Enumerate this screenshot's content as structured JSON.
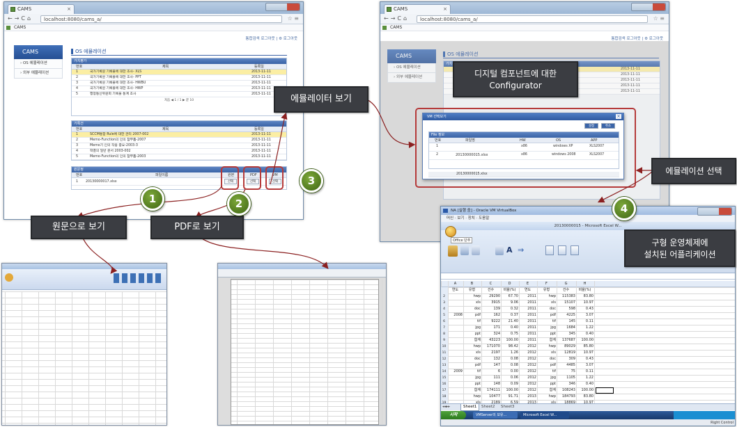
{
  "browser": {
    "tab_title": "CAMS",
    "url": "localhost:8080/cams_a/",
    "bookmark": "CAMS",
    "topright_links": "통합검색 로그아웃 | ⚙ 로그아웃"
  },
  "cams": {
    "app_title": "CAMS",
    "sidebar_items": [
      "› OS 에뮬레이션",
      "› 외부 에뮬레이션"
    ],
    "page_title": "OS 에뮬레이션",
    "section1": {
      "header": "가치평가",
      "columns": [
        "번호",
        "제목",
        "등록일"
      ],
      "rows": [
        {
          "no": "1",
          "title": "국가기록원 기록물에 대한 조사- XLS",
          "date": "2013-11-11",
          "highlight": true
        },
        {
          "no": "2",
          "title": "국가기록원 기록물에 대한 조사- PPT",
          "date": "2013-11-11",
          "highlight": false
        },
        {
          "no": "3",
          "title": "국가기록원 기록물에 대한 조사- HWBU",
          "date": "2013-11-11",
          "highlight": false
        },
        {
          "no": "4",
          "title": "국가기록원 기록물에 대한 조사- HWP",
          "date": "2013-11-11",
          "highlight": false
        },
        {
          "no": "5",
          "title": "행정통신위원회 기록물 통계 조사",
          "date": "2013-11-11",
          "highlight": false
        }
      ],
      "pager": "처음 ◀ 1 / 1 ▶ 끝 10"
    },
    "section2": {
      "header": "기록건",
      "columns": [
        "번호",
        "제목",
        "등록일"
      ],
      "rows": [
        {
          "no": "1",
          "title": "SCCM통합 Rule에 대한 관리 2007-002",
          "date": "2013-11-11",
          "highlight": true
        },
        {
          "no": "2",
          "title": "Memo-Function의 인의 참부품-2007",
          "date": "2013-11-11",
          "highlight": false
        },
        {
          "no": "3",
          "title": "Memo기 인의 작용 중요-2003-3",
          "date": "2013-11-11",
          "highlight": false
        },
        {
          "no": "4",
          "title": "학결의 일반 문서 2003-002",
          "date": "2013-11-11",
          "highlight": false
        },
        {
          "no": "5",
          "title": "Memo-Function의 인의 참부품-2003",
          "date": "2013-11-11",
          "highlight": false
        }
      ]
    },
    "section3": {
      "header": "원문정",
      "columns": [
        "번호",
        "파일이름",
        "원본",
        "PDF",
        "VM"
      ],
      "rows": [
        {
          "no": "1",
          "file": "20130000017.xlsx",
          "original": "선택",
          "pdf": "선택",
          "vm": "선택"
        }
      ]
    }
  },
  "callouts": {
    "original_view": "원문으로 보기",
    "pdf_view": "PDF로 보기",
    "emulator_view": "에뮬레이터 보기",
    "configurator_line1": "디지털 컴포넌트에 대한",
    "configurator_line2": "Configurator",
    "emulation_select": "에뮬레이션 선택",
    "app_line1": "구형 운영체제에",
    "app_line2": "설치된 어플리케이션"
  },
  "badges": [
    "1",
    "2",
    "3",
    "4"
  ],
  "vm_dialog": {
    "title": "VM 선택보기",
    "buttons": [
      "설정",
      "취소"
    ],
    "section": "File 정보",
    "columns": [
      "번호",
      "파일명",
      "HW",
      "OS",
      "APP"
    ],
    "rows": [
      {
        "no": "1",
        "hw": "x86",
        "os": "windows XP",
        "app": "XLS2007"
      },
      {
        "no": "2",
        "hw": "x86",
        "os": "windows 2008",
        "app": "XLS2007"
      }
    ],
    "file": "20130000015.xlsx"
  },
  "vm_window": {
    "title": "NA [실행 중] - Oracle VM VirtualBox",
    "menu": "머신 · 보기 · 장치 · 도움말",
    "excel_title": "20130000015 - Microsoft Excel W...",
    "office_button": "Office 단추",
    "sheet_tabs": [
      "Sheet1",
      "Sheet2",
      "Sheet3"
    ],
    "taskbar_start": "시작",
    "taskbar_items": [
      "VMServer의 보유...",
      "Microsoft Excel W..."
    ],
    "tray": "Right Control",
    "col_headers": [
      "A",
      "B",
      "C",
      "D",
      "E",
      "F",
      "G",
      "H"
    ],
    "header_row": [
      "연도",
      "유형",
      "건수",
      "비율(%)",
      "연도",
      "유형",
      "건수",
      "비율(%)"
    ],
    "rows": [
      [
        "",
        "hwp",
        "29290",
        "67.70",
        "2011",
        "hwp",
        "115383",
        "83.80"
      ],
      [
        "",
        "xls",
        "3915",
        "9.06",
        "2011",
        "xls",
        "15107",
        "10.97"
      ],
      [
        "",
        "doc",
        "139",
        "0.32",
        "2011",
        "doc",
        "598",
        "0.43"
      ],
      [
        "2008",
        "pdf",
        "162",
        "0.37",
        "2011",
        "pdf",
        "4225",
        "3.07"
      ],
      [
        "",
        "tif",
        "9222",
        "21.40",
        "2011",
        "tif",
        "145",
        "0.11"
      ],
      [
        "",
        "jpg",
        "171",
        "0.40",
        "2011",
        "jpg",
        "1684",
        "1.22"
      ],
      [
        "",
        "ppt",
        "324",
        "0.75",
        "2011",
        "ppt",
        "345",
        "0.40"
      ],
      [
        "",
        "합계",
        "43223",
        "100.00",
        "2011",
        "합계",
        "137687",
        "100.00"
      ],
      [
        "",
        "hwp",
        "171070",
        "98.42",
        "2012",
        "hwp",
        "89029",
        "85.80"
      ],
      [
        "",
        "xls",
        "2197",
        "1.26",
        "2012",
        "xls",
        "12819",
        "10.97"
      ],
      [
        "",
        "doc",
        "132",
        "0.08",
        "2012",
        "doc",
        "309",
        "0.43"
      ],
      [
        "",
        "pdf",
        "147",
        "0.08",
        "2012",
        "pdf",
        "4485",
        "3.07"
      ],
      [
        "2009",
        "tif",
        "6",
        "0.00",
        "2012",
        "tif",
        "75",
        "0.11"
      ],
      [
        "",
        "jpg",
        "111",
        "0.06",
        "2012",
        "jpg",
        "1105",
        "1.22"
      ],
      [
        "",
        "ppt",
        "148",
        "0.09",
        "2012",
        "ppt",
        "346",
        "0.40"
      ],
      [
        "",
        "합계",
        "174111",
        "100.00",
        "2012",
        "합계",
        "108243",
        "100.00"
      ],
      [
        "",
        "hwp",
        "10477",
        "91.71",
        "2013",
        "hwp",
        "184793",
        "83.80"
      ],
      [
        "",
        "xls",
        "2189",
        "6.59",
        "2013",
        "xls",
        "18869",
        "10.97"
      ],
      [
        "",
        "doc",
        "26",
        "0.08",
        "2013",
        "doc",
        "679",
        "0.43"
      ]
    ]
  },
  "colors": {
    "callout_bg": "#3b3d42",
    "badge": "#5b8a24",
    "arrow": "#8b2020",
    "highlight_row": "#fbeea3",
    "brand_blue": "#2f5aa0"
  }
}
